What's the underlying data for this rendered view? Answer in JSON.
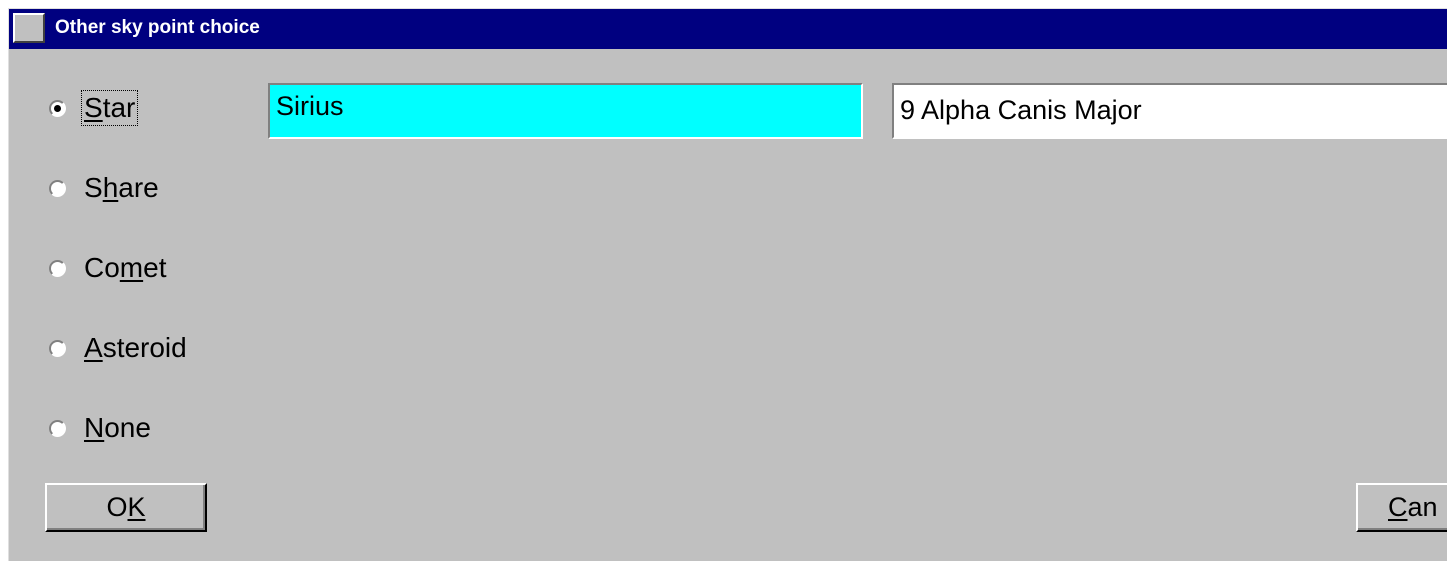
{
  "window": {
    "title": "Other sky point choice"
  },
  "options": [
    {
      "id": "star",
      "pre": "",
      "accel": "S",
      "post": "tar",
      "selected": true
    },
    {
      "id": "share",
      "pre": "S",
      "accel": "h",
      "post": "are",
      "selected": false
    },
    {
      "id": "comet",
      "pre": "Co",
      "accel": "m",
      "post": "et",
      "selected": false
    },
    {
      "id": "asteroid",
      "pre": "",
      "accel": "A",
      "post": "steroid",
      "selected": false
    },
    {
      "id": "none",
      "pre": "",
      "accel": "N",
      "post": "one",
      "selected": false
    }
  ],
  "fields": {
    "name_value": "Sirius",
    "description_value": "9 Alpha Canis Major"
  },
  "buttons": {
    "ok": {
      "pre": "O",
      "accel": "K",
      "post": ""
    },
    "cancel": {
      "pre": "",
      "accel": "C",
      "post": "an"
    }
  },
  "colors": {
    "titlebar": "#000080",
    "dialog_bg": "#c0c0c0",
    "name_field_bg": "#00ffff",
    "description_field_bg": "#ffffff"
  }
}
